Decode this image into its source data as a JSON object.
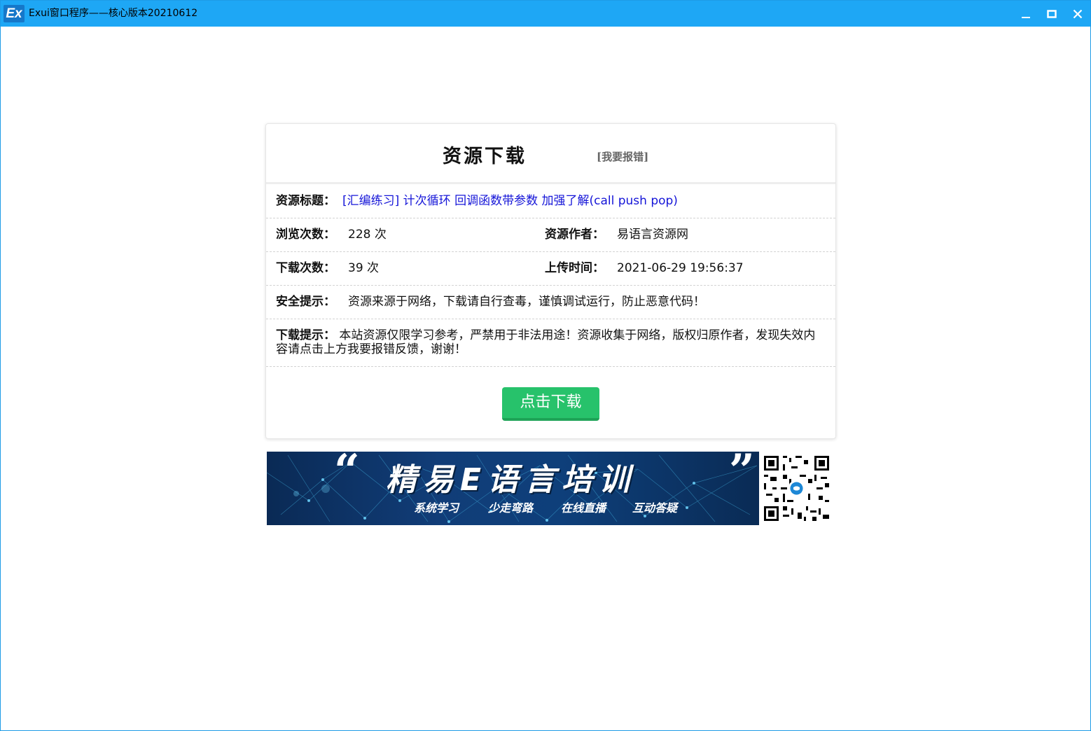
{
  "window": {
    "logo": "Ex",
    "title": "Exui窗口程序——核心版本20210612",
    "icons": [
      "minimize-icon",
      "maximize-icon",
      "close-icon"
    ]
  },
  "card": {
    "title": "资源下载",
    "report_link": "[我要报错]",
    "resource_title_label": "资源标题：",
    "resource_title_value": "[汇编练习] 计次循环 回调函数带参数 加强了解(call push pop)",
    "views_label": "浏览次数：",
    "views_value": "228 次",
    "author_label": "资源作者：",
    "author_value": "易语言资源网",
    "downloads_label": "下载次数：",
    "downloads_value": "39 次",
    "upload_time_label": "上传时间：",
    "upload_time_value": "2021-06-29 19:56:37",
    "safety_label": "安全提示：",
    "safety_value": "资源来源于网络，下载请自行查毒，谨慎调试运行，防止恶意代码！",
    "download_tip_label": "下载提示：",
    "download_tip_value": "本站资源仅限学习参考，严禁用于非法用途！资源收集于网络，版权归原作者，发现失效内容请点击上方我要报错反馈，谢谢！",
    "download_button": "点击下载"
  },
  "banner": {
    "quote_open": "“",
    "quote_close": "”",
    "main_text": "精易E语言培训",
    "tags": [
      "系统学习",
      "少走弯路",
      "在线直播",
      "互动答疑"
    ]
  },
  "colors": {
    "titlebar": "#1ea7f5",
    "link": "#1515d8",
    "button": "#27c26b"
  }
}
